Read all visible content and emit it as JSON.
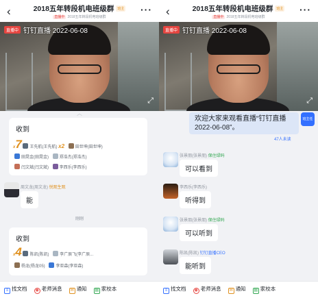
{
  "left": {
    "header": {
      "title": "2018五年转段机电班级群",
      "tag": "班主",
      "sub_badge": "直播中",
      "sub_text": "2018五年转段机电班级群"
    },
    "video": {
      "live_badge": "直播中",
      "live_title": "钉钉直播 2022-06-08"
    },
    "card1": {
      "title": "收到",
      "count_prefix": "x",
      "count": "7",
      "row1": [
        {
          "name": "王先航(王先航)",
          "extra": "x2"
        },
        {
          "name": "田世坤(田世坤)"
        }
      ],
      "row2": [
        {
          "name": "田晃金(田晃金)"
        },
        {
          "name": "郑浩杰(郑浩杰)"
        }
      ],
      "row3": [
        {
          "name": "闫文斌(闫文斌)"
        },
        {
          "name": "李西乐(李西乐)"
        }
      ]
    },
    "message1": {
      "sender": "周文龙(周文龙)",
      "role": "悦观生观",
      "text": "能"
    },
    "divider": "刚刚",
    "card2": {
      "title": "收到",
      "count_prefix": "x",
      "count": "4",
      "row1": [
        {
          "name": "陈凯(陈凯)"
        },
        {
          "name": "李广辰飞(李广辰..."
        }
      ],
      "row2": [
        {
          "name": "杨龙(杨龙05)"
        },
        {
          "name": "李亚森(李亚森)"
        }
      ]
    }
  },
  "right": {
    "header": {
      "title": "2018五年转段机电班级群",
      "tag": "班主",
      "sub_badge": "直播中",
      "sub_text": "2018五年转段机电班级群"
    },
    "video": {
      "live_badge": "直播中",
      "live_title": "钉钉直播 2022-06-08"
    },
    "system_bubble": {
      "line1": "欢迎大家来观看直播“钉钉直播",
      "line2": "2022-06-08”。"
    },
    "unread": "47人未读",
    "self_avatar": "班主任",
    "messages": [
      {
        "sender": "张景朋(张景朋)",
        "role": "保住绿码",
        "text": "可以看到"
      },
      {
        "sender": "李西乐(李西乐)",
        "role": "",
        "text": "听得到"
      },
      {
        "sender": "张景朋(张景朋)",
        "role": "保住绿码",
        "text": "可以听到"
      },
      {
        "sender": "陈凯(陈凯)",
        "role": "钉钉直播CEO",
        "text": "能听到"
      }
    ]
  },
  "bottom_bar": [
    {
      "icon": "doc-icon",
      "label": "找文档"
    },
    {
      "icon": "teacher-icon",
      "label": "老师消息"
    },
    {
      "icon": "notice-icon",
      "label": "通知"
    },
    {
      "icon": "school-icon",
      "label": "家校本"
    }
  ]
}
